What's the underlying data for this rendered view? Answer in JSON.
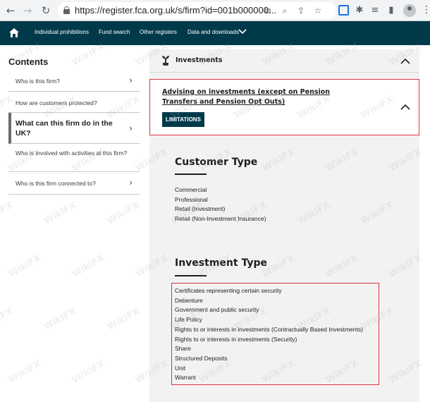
{
  "browser": {
    "url": "https://register.fca.org.uk/s/firm?id=001b000000..."
  },
  "site_nav": {
    "links": [
      "Individual prohibitions",
      "Fund search",
      "Other registers",
      "Data and downloads"
    ]
  },
  "sidebar": {
    "title": "Contents",
    "items": [
      {
        "label": "Who is this firm?"
      },
      {
        "label": "How are customers protected?"
      },
      {
        "label": "What can this firm do in the UK?"
      },
      {
        "label": "Who is involved with activities at this firm?"
      },
      {
        "label": "Who is this firm connected to?"
      }
    ]
  },
  "main": {
    "section_title": "Investments",
    "activity": {
      "title": "Advising on investments (except on Pension Transfers and Pension Opt Outs)",
      "badge": "LIMITATIONS"
    },
    "customer_type": {
      "heading": "Customer Type",
      "items": [
        "Commercial",
        "Professional",
        "Retail (Investment)",
        "Retail (Non-Investment Insurance)"
      ]
    },
    "investment_type": {
      "heading": "Investment Type",
      "items": [
        "Certificates representing certain security",
        "Debenture",
        "Government and public security",
        "Life Policy",
        "Rights to or interests in investments (Contractually Based Investments)",
        "Rights to or interests in investments (Security)",
        "Share",
        "Structured Deposits",
        "Unit",
        "Warrant"
      ]
    }
  },
  "watermark": {
    "text": "WikiFX"
  },
  "colors": {
    "navbar": "#003a4a",
    "highlight": "#d9363e",
    "panel": "#f2f2f2"
  }
}
